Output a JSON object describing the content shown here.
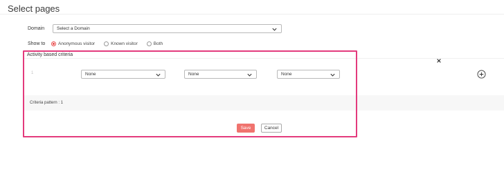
{
  "header": {
    "title": "Select pages"
  },
  "domain": {
    "label": "Domain",
    "selected": "Select a Domain"
  },
  "show_to": {
    "label": "Show to",
    "options": [
      {
        "label": "Anonymous visitor",
        "checked": true
      },
      {
        "label": "Known visitor",
        "checked": false
      },
      {
        "label": "Both",
        "checked": false
      }
    ]
  },
  "criteria": {
    "title": "Activity based criteria",
    "row_index": "1",
    "selects": [
      "None",
      "None",
      "None"
    ],
    "pattern": "Criteria pattern : 1"
  },
  "actions": {
    "save": "Save",
    "cancel": "Cancel"
  },
  "colors": {
    "accent": "#e94b4b",
    "highlight_border": "#e33a7c",
    "save_bg": "#f0736e"
  }
}
